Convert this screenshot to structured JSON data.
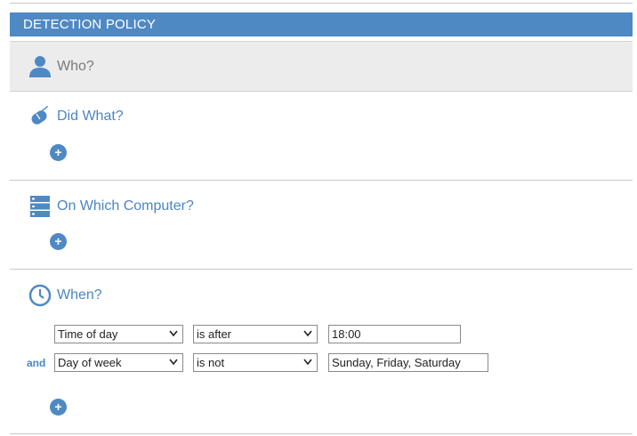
{
  "panel": {
    "title": "DETECTION POLICY"
  },
  "sections": {
    "who": {
      "title": "Who?",
      "icon": "user-icon"
    },
    "did_what": {
      "title": "Did What?",
      "icon": "mouse-icon",
      "add_label": "+"
    },
    "on_which_computer": {
      "title": "On Which Computer?",
      "icon": "server-icon",
      "add_label": "+"
    },
    "when": {
      "title": "When?",
      "icon": "clock-icon",
      "add_label": "+",
      "conditions": [
        {
          "connector": "",
          "field": "Time of day",
          "operator": "is after",
          "value": "18:00"
        },
        {
          "connector": "and",
          "field": "Day of week",
          "operator": "is not",
          "value": "Sunday, Friday, Saturday"
        }
      ]
    }
  },
  "colors": {
    "accent": "#4f89c4",
    "header_text": "#ffffff",
    "who_background": "#ececec"
  }
}
